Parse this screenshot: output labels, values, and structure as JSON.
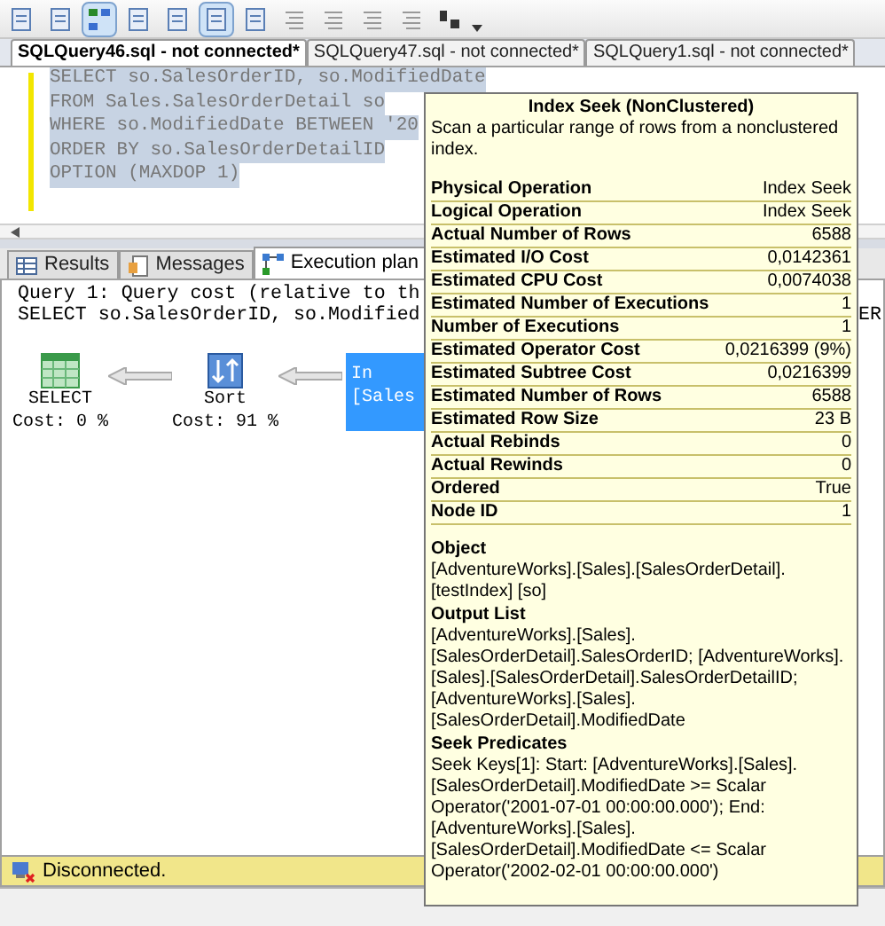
{
  "document_tabs": [
    {
      "label": "SQLQuery46.sql - not connected*",
      "selected": true
    },
    {
      "label": "SQLQuery47.sql - not connected*",
      "selected": false
    },
    {
      "label": "SQLQuery1.sql - not connected*",
      "selected": false
    }
  ],
  "editor": {
    "highlighted": true,
    "lines": [
      "SELECT so.SalesOrderID, so.ModifiedDate",
      "FROM Sales.SalesOrderDetail so",
      "WHERE so.ModifiedDate BETWEEN '20",
      "ORDER BY so.SalesOrderDetailID",
      "OPTION (MAXDOP 1)"
    ]
  },
  "result_tabs": [
    {
      "label": "Results",
      "kind": "grid",
      "selected": false
    },
    {
      "label": "Messages",
      "kind": "messages",
      "selected": false
    },
    {
      "label": "Execution plan",
      "kind": "plan",
      "selected": true
    }
  ],
  "plan_header": {
    "lines": [
      "Query 1: Query cost (relative to th",
      "SELECT so.SalesOrderID, so.Modified"
    ],
    "tail": "ER"
  },
  "plan_nodes": [
    {
      "kind": "select",
      "selected": false,
      "lines": [
        "SELECT",
        "Cost: 0 %"
      ]
    },
    {
      "kind": "sort",
      "selected": false,
      "lines": [
        "Sort",
        "Cost: 91 %"
      ]
    },
    {
      "kind": "index_seek",
      "selected": true,
      "lines": [
        "In",
        "[Sales"
      ]
    }
  ],
  "tooltip": {
    "title": "Index Seek (NonClustered)",
    "description": "Scan a particular range of rows from a nonclustered index.",
    "properties": [
      {
        "name": "Physical Operation",
        "value": "Index Seek"
      },
      {
        "name": "Logical Operation",
        "value": "Index Seek"
      },
      {
        "name": "Actual Number of Rows",
        "value": "6588"
      },
      {
        "name": "Estimated I/O Cost",
        "value": "0,0142361"
      },
      {
        "name": "Estimated CPU Cost",
        "value": "0,0074038"
      },
      {
        "name": "Estimated Number of Executions",
        "value": "1"
      },
      {
        "name": "Number of Executions",
        "value": "1"
      },
      {
        "name": "Estimated Operator Cost",
        "value": "0,0216399 (9%)"
      },
      {
        "name": "Estimated Subtree Cost",
        "value": "0,0216399"
      },
      {
        "name": "Estimated Number of Rows",
        "value": "6588"
      },
      {
        "name": "Estimated Row Size",
        "value": "23 B"
      },
      {
        "name": "Actual Rebinds",
        "value": "0"
      },
      {
        "name": "Actual Rewinds",
        "value": "0"
      },
      {
        "name": "Ordered",
        "value": "True"
      },
      {
        "name": "Node ID",
        "value": "1"
      }
    ],
    "sections": [
      {
        "heading": "Object",
        "text": "[AdventureWorks].[Sales].[SalesOrderDetail].[testIndex] [so]"
      },
      {
        "heading": "Output List",
        "text": "[AdventureWorks].[Sales].[SalesOrderDetail].SalesOrderID; [AdventureWorks].[Sales].[SalesOrderDetail].SalesOrderDetailID; [AdventureWorks].[Sales].[SalesOrderDetail].ModifiedDate"
      },
      {
        "heading": "Seek Predicates",
        "text": "Seek Keys[1]: Start: [AdventureWorks].[Sales].[SalesOrderDetail].ModifiedDate >= Scalar Operator('2001-07-01 00:00:00.000'); End: [AdventureWorks].[Sales].[SalesOrderDetail].ModifiedDate <= Scalar Operator('2002-02-01 00:00:00.000')"
      }
    ]
  },
  "status_bar": {
    "text": "Disconnected."
  }
}
